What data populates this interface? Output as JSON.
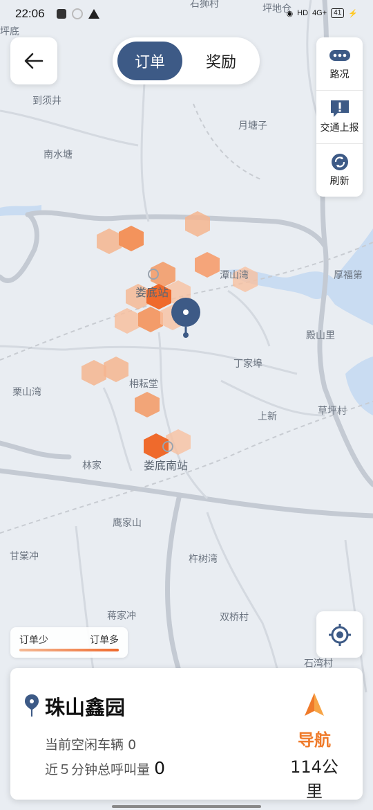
{
  "status_bar": {
    "time": "22:06",
    "network": "4G+",
    "hd": "HD",
    "battery": "41"
  },
  "header": {
    "tabs": [
      {
        "label": "订单",
        "active": true
      },
      {
        "label": "奖励",
        "active": false
      }
    ]
  },
  "side_tools": [
    {
      "label": "路况",
      "icon": "more-dots-icon"
    },
    {
      "label": "交通上报",
      "icon": "report-icon"
    },
    {
      "label": "刷新",
      "icon": "refresh-icon"
    }
  ],
  "map": {
    "labels": [
      "石狮村",
      "坪地仓",
      "坪底",
      "到须井",
      "月塘子",
      "南水塘",
      "潭山湾",
      "厚福第",
      "娄底站",
      "殿山里",
      "丁家埠",
      "栗山湾",
      "枏耘堂",
      "草坪村",
      "上新",
      "林家",
      "娄底南站",
      "鹰家山",
      "甘棠冲",
      "杵树湾",
      "双桥村",
      "蒋家冲",
      "石湾村"
    ]
  },
  "legend": {
    "low": "订单少",
    "high": "订单多",
    "colors": [
      "#f4b995",
      "#ef6a2c"
    ]
  },
  "card": {
    "location_name": "珠山鑫园",
    "idle_vehicles_label": "当前空闲车辆",
    "idle_vehicles": "0",
    "calls_label": "近５分钟总呼叫量",
    "calls": "0",
    "nav_label": "导航",
    "distance": "114公里"
  },
  "colors": {
    "accent": "#3d5a86",
    "nav": "#ef7a2a",
    "heat_low": "#f4b995",
    "heat_high": "#ef6a2c"
  }
}
